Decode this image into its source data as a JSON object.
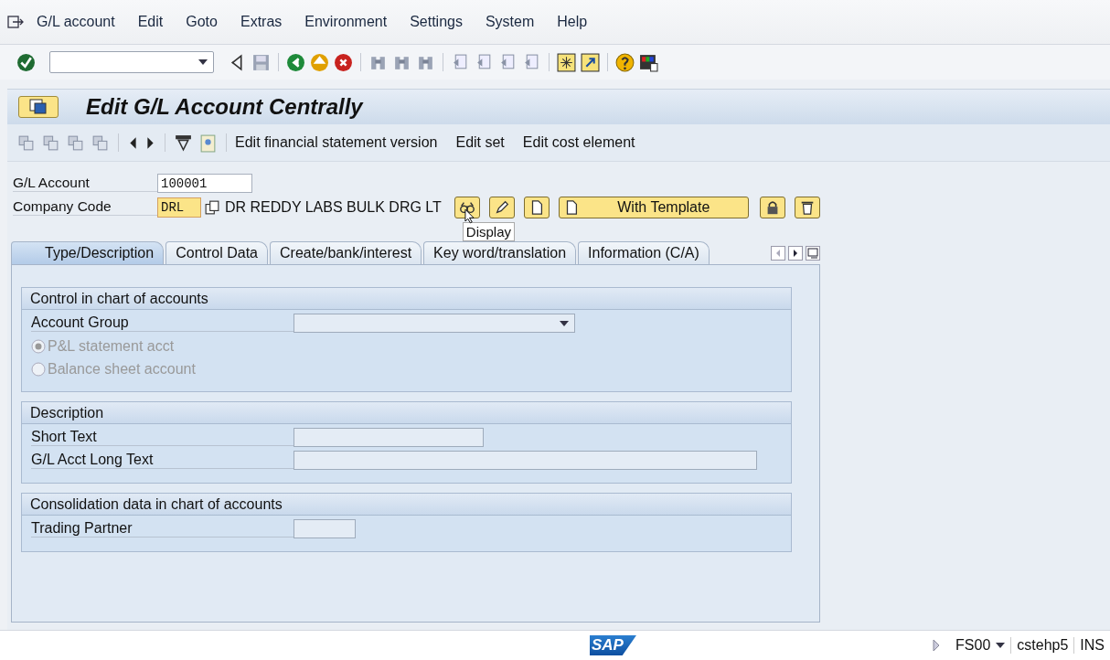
{
  "menu": [
    "G/L account",
    "Edit",
    "Goto",
    "Extras",
    "Environment",
    "Settings",
    "System",
    "Help"
  ],
  "title": "Edit G/L Account Centrally",
  "app_toolbar": [
    "Edit financial statement version",
    "Edit set",
    "Edit cost element"
  ],
  "gl_account": {
    "label": "G/L Account",
    "value": "100001"
  },
  "company_code": {
    "label": "Company Code",
    "value": "DRL",
    "description": "DR REDDY LABS BULK DRG LT"
  },
  "template_button": "With Template",
  "tooltip": "Display",
  "tabs": [
    {
      "label": "Type/Description",
      "selected": true
    },
    {
      "label": "Control Data",
      "selected": false
    },
    {
      "label": "Create/bank/interest",
      "selected": false
    },
    {
      "label": "Key word/translation",
      "selected": false
    },
    {
      "label": "Information (C/A)",
      "selected": false
    }
  ],
  "sections": [
    {
      "title": "Control in chart of accounts",
      "rows": [
        {
          "kind": "dropdown",
          "label": "Account Group"
        },
        {
          "kind": "radio",
          "label": "P&L statement acct",
          "selected": true,
          "disabled": true
        },
        {
          "kind": "radio",
          "label": "Balance sheet account",
          "selected": false,
          "disabled": true
        }
      ]
    },
    {
      "title": "Description",
      "rows": [
        {
          "kind": "text",
          "label": "Short Text"
        },
        {
          "kind": "longtext",
          "label": "G/L Acct Long Text"
        }
      ]
    },
    {
      "title": "Consolidation data in chart of accounts",
      "rows": [
        {
          "kind": "code",
          "label": "Trading Partner"
        }
      ]
    }
  ],
  "logo": "SAP",
  "status_bar": {
    "transaction": "FS00",
    "server": "cstehp5",
    "mode": "INS"
  }
}
